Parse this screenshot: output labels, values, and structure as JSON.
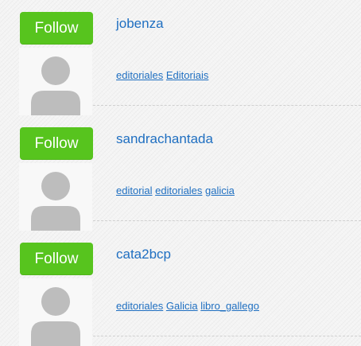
{
  "users": [
    {
      "follow_label": "Follow",
      "username": "jobenza",
      "tags": [
        "editoriales",
        "Editoriais"
      ]
    },
    {
      "follow_label": "Follow",
      "username": "sandrachantada",
      "tags": [
        "editorial",
        "editoriales",
        "galicia"
      ]
    },
    {
      "follow_label": "Follow",
      "username": "cata2bcp",
      "tags": [
        "editoriales",
        "Galicia",
        "libro_gallego"
      ]
    }
  ],
  "colors": {
    "follow_button": "#57c41e",
    "link": "#1f6fc1",
    "avatar_placeholder": "#bdbdbd"
  },
  "icons": {
    "avatar": "user-placeholder-icon"
  }
}
